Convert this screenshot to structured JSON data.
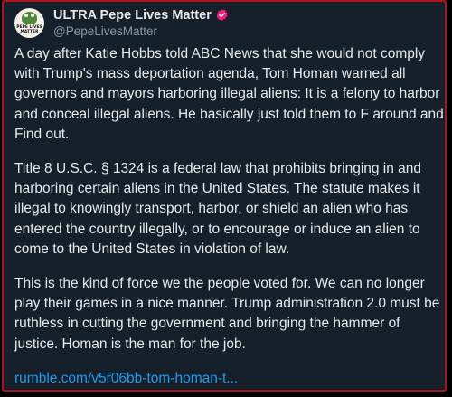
{
  "author": {
    "display_name": "ULTRA Pepe Lives Matter",
    "handle": "@PepeLivesMatter",
    "avatar_text": "PEPE LIVES MATTER",
    "verified_icon": "verified-badge-icon",
    "verified_color": "#f91880"
  },
  "post": {
    "paragraphs": [
      "A day after Katie Hobbs told ABC News that she would not comply with Trump's mass deportation agenda, Tom Homan warned all governors and mayors harboring illegal aliens: It is a felony to harbor and conceal illegal aliens. He basically just told them to F around and Find out.",
      "Title 8 U.S.C. § 1324 is a federal law that prohibits bringing in and harboring certain aliens in the United States. The statute makes it illegal to knowingly transport, harbor, or shield an alien who has entered the country illegally, or to encourage or induce an alien to come to the United States in violation of law.",
      "This is the kind of force we the people voted for. We can no longer play their games in a nice manner. Trump administration 2.0 must be ruthless in cutting the government and bringing the hammer of justice. Homan is the man for the job."
    ],
    "link_text": "rumble.com/v5r06bb-tom-homan-t..."
  },
  "colors": {
    "background": "#15202b",
    "border": "#b0121b",
    "text": "#e7e9ea",
    "muted": "#8b98a5",
    "link": "#1d9bf0"
  }
}
